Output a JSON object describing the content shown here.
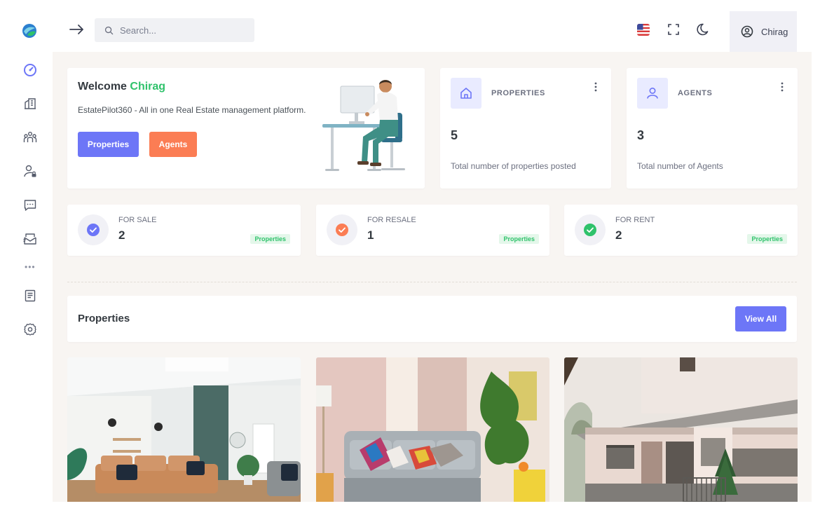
{
  "app": {
    "search": {
      "placeholder": "Search..."
    },
    "user": {
      "name": "Chirag"
    },
    "colors": {
      "primary": "#6d76f7",
      "accent_orange": "#fb7d54",
      "success": "#2fc26b",
      "background": "#f8f5f2"
    },
    "icons": {
      "logo": "app-logo",
      "topbar": [
        "arrow-right-icon",
        "search-icon",
        "us-flag-icon",
        "fullscreen-icon",
        "moon-icon",
        "user-circle-icon"
      ],
      "sidebar": [
        "dashboard-icon",
        "buildings-icon",
        "agents-icon",
        "user-lock-icon",
        "chat-icon",
        "mail-icon",
        "more-icon",
        "document-icon",
        "settings-icon"
      ]
    }
  },
  "welcome": {
    "prefix": "Welcome",
    "name": "Chirag",
    "subtitle": "EstatePilot360 - All in one Real Estate management platform.",
    "buttons": {
      "properties": "Properties",
      "agents": "Agents"
    }
  },
  "stats": [
    {
      "label": "PROPERTIES",
      "value": "5",
      "caption": "Total number of properties posted"
    },
    {
      "label": "AGENTS",
      "value": "3",
      "caption": "Total number of Agents"
    }
  ],
  "mini_stats": [
    {
      "label": "FOR SALE",
      "value": "2",
      "badge": "Properties",
      "color": "#6d76f7"
    },
    {
      "label": "FOR RESALE",
      "value": "1",
      "badge": "Properties",
      "color": "#fb7d54"
    },
    {
      "label": "FOR RENT",
      "value": "2",
      "badge": "Properties",
      "color": "#2fc26b"
    }
  ],
  "properties_section": {
    "title": "Properties",
    "view_all": "View All"
  }
}
